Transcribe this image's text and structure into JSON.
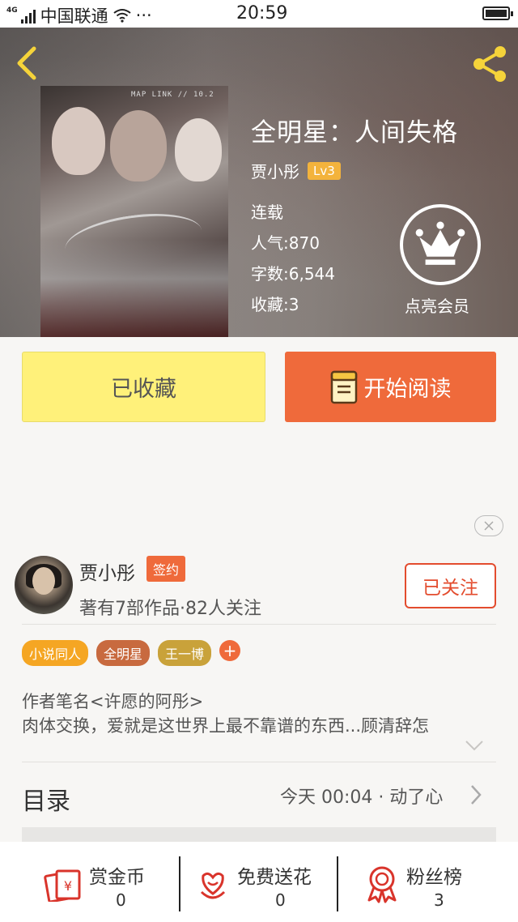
{
  "status_bar": {
    "network_type": "4G",
    "carrier": "中国联通",
    "more": "···",
    "time": "20:59"
  },
  "book": {
    "title": "全明星：人间失格",
    "author": "贾小彤",
    "level": "Lv3",
    "status": "连载",
    "popularity_label": "人气:",
    "popularity": "870",
    "word_count_label": "字数:",
    "word_count": "6,544",
    "favorites_label": "收藏:",
    "favorites": "3",
    "cover_text": "MAP LINK // 10.2"
  },
  "vip": {
    "label": "点亮会员"
  },
  "actions": {
    "collected_label": "已收藏",
    "read_label": "开始阅读"
  },
  "author_card": {
    "name": "贾小彤",
    "badge": "签约",
    "stats": "著有7部作品·82人关注",
    "follow_label": "已关注"
  },
  "tags": [
    {
      "label": "小说同人",
      "color": "#f5a623"
    },
    {
      "label": "全明星",
      "color": "#c86a3f"
    },
    {
      "label": "王一博",
      "color": "#c9a23a"
    }
  ],
  "tag_add": "+",
  "intro": {
    "line1": "作者笔名<许愿的阿彤>",
    "line2": "肉体交换，爱就是这世界上最不靠谱的东西...顾清辞怎"
  },
  "toc": {
    "title": "目录",
    "update": "今天 00:04 · 动了心"
  },
  "bottom_bar": {
    "items": [
      {
        "label": "赏金币",
        "count": "0",
        "icon": "red-envelope-icon"
      },
      {
        "label": "免费送花",
        "count": "0",
        "icon": "flower-icon"
      },
      {
        "label": "粉丝榜",
        "count": "3",
        "icon": "medal-icon"
      }
    ]
  },
  "colors": {
    "accent": "#ef6a3b",
    "collected_bg": "#fff17a",
    "follow_border": "#e34c2e",
    "level_badge": "#f3b33c",
    "icon_red": "#d9342b"
  }
}
